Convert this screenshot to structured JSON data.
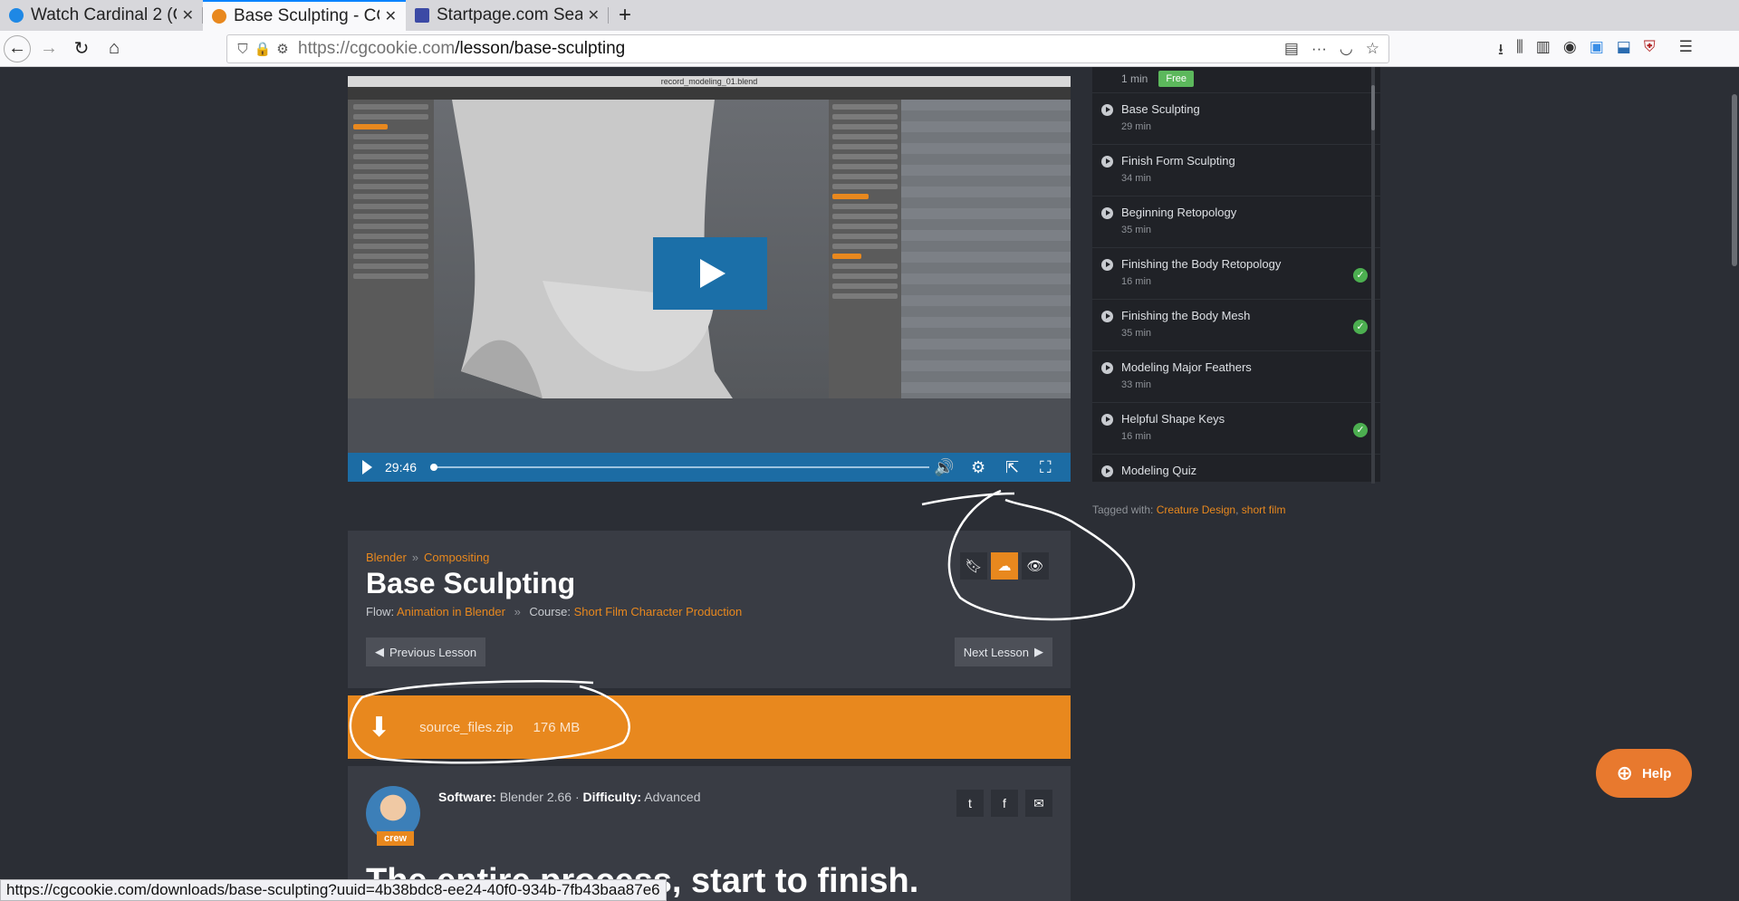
{
  "browser": {
    "tabs": [
      {
        "title": "Watch Cardinal 2 (C",
        "active": false,
        "color": "#1e88e5"
      },
      {
        "title": "Base Sculpting - CG",
        "active": true,
        "color": "#e8881e"
      },
      {
        "title": "Startpage.com Sea",
        "active": false,
        "color": "#3c4aa5"
      }
    ],
    "url_prefix": "https://cgcookie.com",
    "url_path": "/lesson/base-sculpting",
    "status_url": "https://cgcookie.com/downloads/base-sculpting?uuid=4b38bdc8-ee24-40f0-934b-7fb43baa87e6"
  },
  "video": {
    "window_title": "record_modeling_01.blend",
    "time": "29:46",
    "progress": 0.0
  },
  "playlist": {
    "top_duration": "1 min",
    "top_badge": "Free",
    "items": [
      {
        "title": "Base Sculpting",
        "duration": "29 min",
        "done": false
      },
      {
        "title": "Finish Form Sculpting",
        "duration": "34 min",
        "done": false
      },
      {
        "title": "Beginning Retopology",
        "duration": "35 min",
        "done": false
      },
      {
        "title": "Finishing the Body Retopology",
        "duration": "16 min",
        "done": true
      },
      {
        "title": "Finishing the Body Mesh",
        "duration": "35 min",
        "done": true
      },
      {
        "title": "Modeling Major Feathers",
        "duration": "33 min",
        "done": false
      },
      {
        "title": "Helpful Shape Keys",
        "duration": "16 min",
        "done": true
      },
      {
        "title": "Modeling Quiz",
        "duration": "",
        "done": false
      }
    ]
  },
  "tags": {
    "label": "Tagged with:",
    "items": [
      "Creature Design",
      "short film"
    ]
  },
  "lesson": {
    "crumb1": "Blender",
    "crumb2": "Compositing",
    "title": "Base Sculpting",
    "flow_label": "Flow:",
    "flow_value": "Animation in Blender",
    "course_label": "Course:",
    "course_value": "Short Film Character Production",
    "prev_label": "Previous Lesson",
    "next_label": "Next Lesson"
  },
  "download": {
    "filename": "source_files.zip",
    "size": "176 MB"
  },
  "meta": {
    "badge": "crew",
    "software_label": "Software:",
    "software_value": "Blender 2.66",
    "difficulty_label": "Difficulty:",
    "difficulty_value": "Advanced",
    "tagline": "The entire process, start to finish."
  },
  "help": {
    "label": "Help"
  },
  "colors": {
    "accent": "#e8881e",
    "video_blue": "#1c6ca4",
    "page_bg": "#2b2e35"
  }
}
